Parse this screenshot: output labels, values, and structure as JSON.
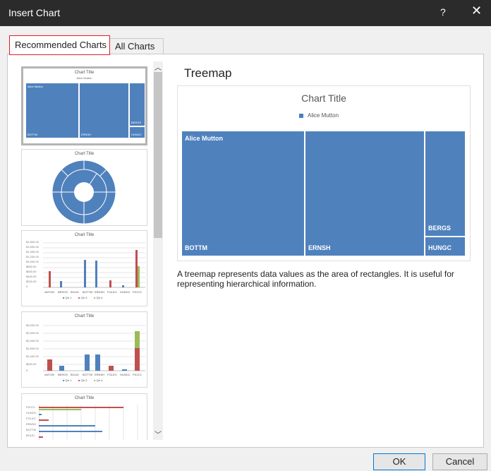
{
  "window": {
    "title": "Insert Chart",
    "help_label": "?",
    "close_label": "✕"
  },
  "tabs": [
    {
      "label": "Recommended Charts",
      "active": true
    },
    {
      "label": "All Charts",
      "active": false
    }
  ],
  "thumbnails": [
    {
      "title": "Chart Title",
      "legend": "Alice Mutton",
      "kind": "treemap",
      "labels": [
        "Alice Mutton",
        "BOTTM",
        "ERNSH",
        "BERGS",
        "HUNGC"
      ]
    },
    {
      "title": "Chart Title",
      "kind": "sunburst"
    },
    {
      "title": "Chart Title",
      "kind": "clustered-column",
      "axis_labels": [
        "$1,800.00",
        "$1,600.00",
        "$1,400.00",
        "$1,200.00",
        "$1,000.00",
        "$800.00",
        "$600.00",
        "$400.00",
        "$200.00",
        "0"
      ],
      "categories": [
        "ANTON",
        "BERGS",
        "BOLID",
        "BOTTM",
        "ERNSH",
        "FOLKO",
        "HUNGC",
        "PICCO"
      ],
      "legend": [
        "Qtr 1",
        "Qtr 3",
        "Qtr 4"
      ]
    },
    {
      "title": "Chart Title",
      "kind": "stacked-column",
      "axis_labels": [
        "$3,000.00",
        "$2,500.00",
        "$2,000.00",
        "$1,500.00",
        "$1,000.00",
        "$500.00",
        "0"
      ],
      "categories": [
        "ANTON",
        "BERGS",
        "BOLID",
        "BOTTM",
        "ERNSH",
        "FOLKO",
        "HUNGC",
        "PICCO"
      ],
      "legend": [
        "Qtr 1",
        "Qtr 3",
        "Qtr 4"
      ]
    },
    {
      "title": "Chart Title",
      "kind": "clustered-bar",
      "axis_labels": [
        "PICCO",
        "HUNGC",
        "FOLKO",
        "ERNSH",
        "BOTTM",
        "BOLID"
      ]
    }
  ],
  "preview": {
    "heading": "Treemap",
    "chart_title": "Chart Title",
    "legend": "Alice Mutton",
    "tiles": [
      "Alice Mutton",
      "BOTTM",
      "ERNSH",
      "BERGS",
      "HUNGC"
    ]
  },
  "description": "A treemap represents data values as the area of rectangles. It is useful for representing hierarchical information.",
  "buttons": {
    "ok": "OK",
    "cancel": "Cancel"
  },
  "colors": {
    "series_blue": "#4f81bd",
    "series_red": "#c0504d",
    "series_green": "#9bbb59",
    "selected_tab_border": "#e11d2a"
  },
  "icons": {
    "scroll_up": "chevron-up-icon",
    "scroll_down": "chevron-down-icon",
    "close": "close-icon",
    "help": "help-icon"
  }
}
